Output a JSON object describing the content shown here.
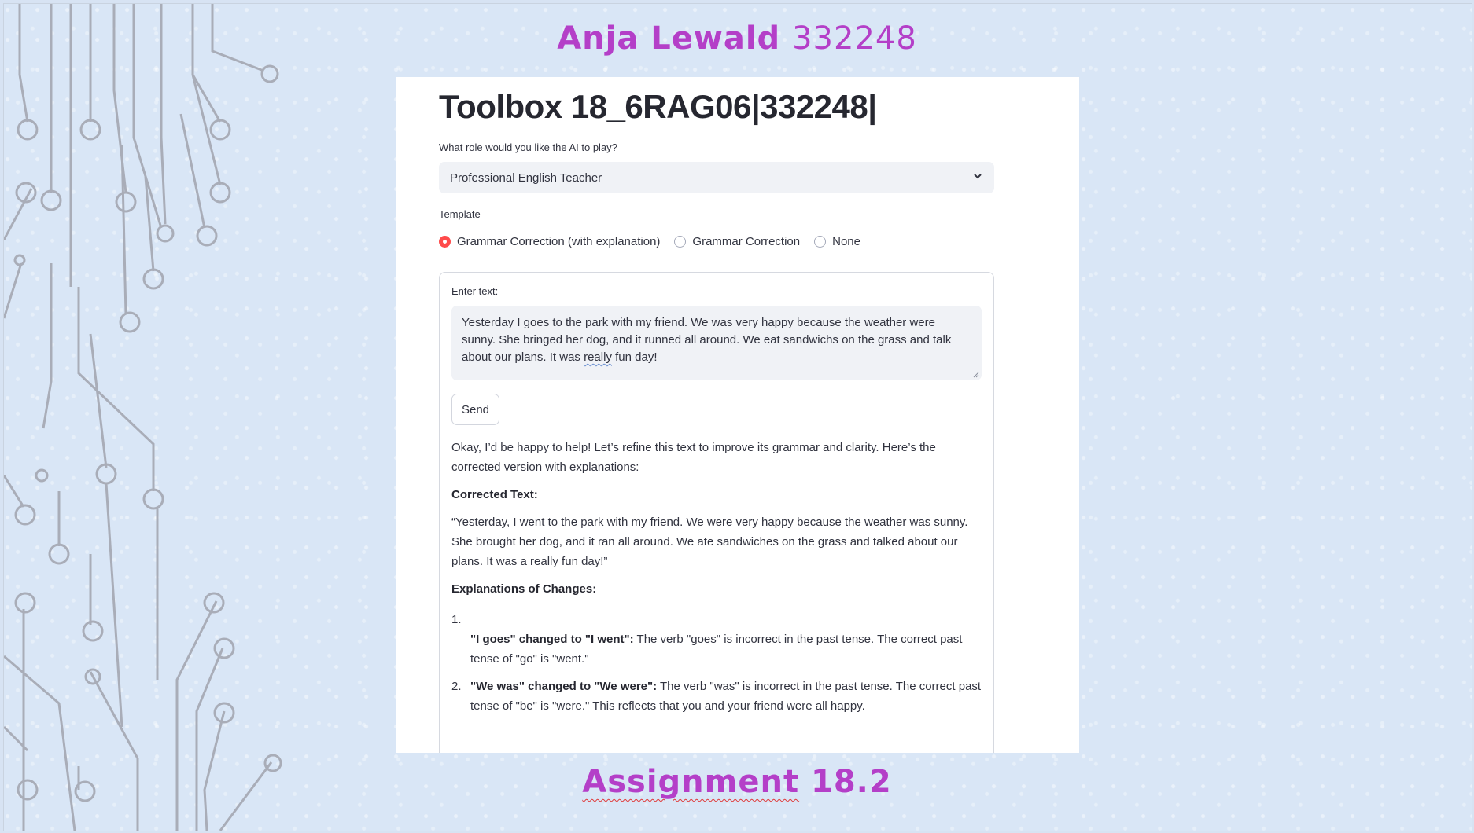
{
  "slide": {
    "title_name": "Anja Lewald",
    "title_id": "332248",
    "footer_word": "Assignment",
    "footer_number": "18.2"
  },
  "app": {
    "title": "Toolbox 18_6RAG06|332248|",
    "role_label": "What role would you like the AI to play?",
    "role_value": "Professional English Teacher",
    "template_label": "Template",
    "template_options": [
      {
        "label": "Grammar Correction (with explanation)",
        "selected": true
      },
      {
        "label": "Grammar Correction",
        "selected": false
      },
      {
        "label": "None",
        "selected": false
      }
    ],
    "input_label": "Enter text:",
    "input_text_a": "Yesterday I goes to the park with my friend. We was very happy because the weather were sunny. She bringed her dog, and it runned all around. We eat sandwichs on the grass and talk about our plans. It was ",
    "input_text_b": "really",
    "input_text_c": " fun day!",
    "send_label": "Send",
    "response": {
      "intro": "Okay, I’d be happy to help! Let’s refine this text to improve its grammar and clarity. Here’s the corrected version with explanations:",
      "corrected_heading": "Corrected Text:",
      "corrected_text": "“Yesterday, I went to the park with my friend. We were very happy because the weather was sunny. She brought her dog, and it ran all around. We ate sandwiches on the grass and talked about our plans. It was a really fun day!”",
      "explanations_heading": "Explanations of Changes:",
      "items": [
        {
          "num": "1.",
          "bold": "\"I goes\" changed to \"I went\":",
          "text": " The verb \"goes\" is incorrect in the past tense. The correct past tense of \"go\" is \"went.\""
        },
        {
          "num": "2.",
          "bold": "\"We was\" changed to \"We were\":",
          "text": " The verb \"was\" is incorrect in the past tense. The correct past tense of \"be\" is \"were.\" This reflects that you and your friend were all happy."
        }
      ]
    }
  },
  "colors": {
    "accent_title": "#b43fc8",
    "radio_selected": "#ff4b4b",
    "background": "#d9e6f6"
  },
  "icons": [
    "chevron-down-icon",
    "resize-handle-icon"
  ]
}
